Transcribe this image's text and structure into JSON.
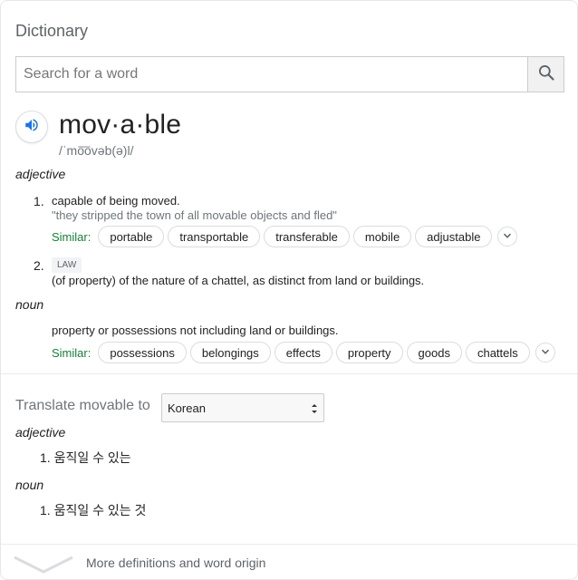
{
  "card": {
    "title": "Dictionary"
  },
  "search": {
    "placeholder": "Search for a word",
    "value": ""
  },
  "entry": {
    "headword": "mov·a·ble",
    "phonetic": "/ˈmo͞ovəb(ə)l/",
    "senses": [
      {
        "pos": "adjective",
        "defs": [
          {
            "number": "1.",
            "text": "capable of being moved.",
            "example": "\"they stripped the town of all movable objects and fled\"",
            "similar_label": "Similar:",
            "similar": [
              "portable",
              "transportable",
              "transferable",
              "mobile",
              "adjustable"
            ]
          },
          {
            "number": "2.",
            "label": "LAW",
            "text": "(of property) of the nature of a chattel, as distinct from land or buildings."
          }
        ]
      },
      {
        "pos": "noun",
        "defs": [
          {
            "text": "property or possessions not including land or buildings.",
            "similar_label": "Similar:",
            "similar": [
              "possessions",
              "belongings",
              "effects",
              "property",
              "goods",
              "chattels"
            ]
          }
        ]
      }
    ]
  },
  "translate": {
    "label": "Translate movable to",
    "language": "Korean",
    "sections": [
      {
        "pos": "adjective",
        "items": [
          {
            "number": "1.",
            "text": "움직일 수 있는"
          }
        ]
      },
      {
        "pos": "noun",
        "items": [
          {
            "number": "1.",
            "text": "움직일 수 있는 것"
          }
        ]
      }
    ]
  },
  "footer": {
    "text": "More definitions and word origin"
  },
  "colors": {
    "similar_label": "#188038",
    "speaker_icon": "#1a73e8"
  },
  "icons": {
    "search": "search-icon",
    "speaker": "speaker-icon",
    "expand": "chevron-down-icon",
    "select": "select-arrows-icon",
    "footer": "chevron-down-icon"
  }
}
